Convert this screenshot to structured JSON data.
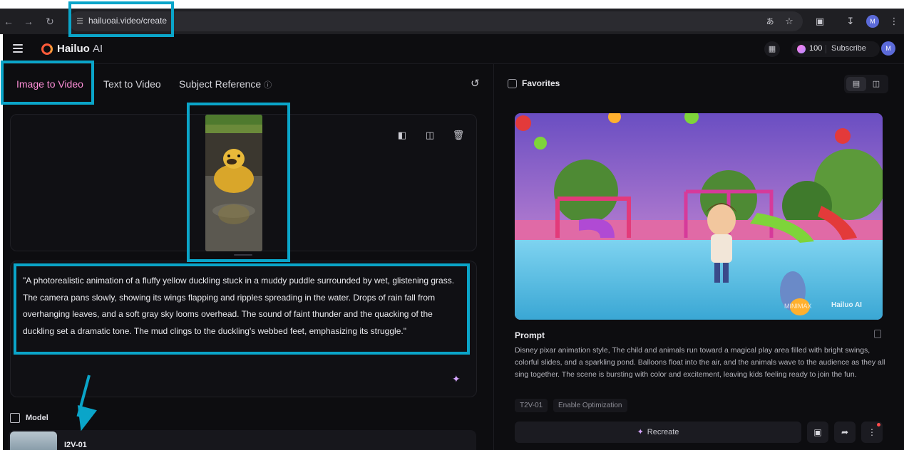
{
  "browser": {
    "url": "hailuoai.video/create",
    "profile_initial": "M"
  },
  "header": {
    "brand_name": "Hailuo",
    "brand_suffix": "AI",
    "credits": "100",
    "subscribe_label": "Subscribe",
    "avatar_initial": "M"
  },
  "tabs": [
    {
      "label": "Image to Video",
      "active": true
    },
    {
      "label": "Text to Video",
      "active": false
    },
    {
      "label": "Subject Reference",
      "active": false
    }
  ],
  "subject_reference_info_glyph": "ⓘ",
  "prompt": {
    "text": "\"A photorealistic animation of a fluffy yellow duckling stuck in a muddy puddle surrounded by wet, glistening grass. The camera pans slowly, showing its wings flapping and ripples spreading in the water. Drops of rain fall from overhanging leaves, and a soft gray sky looms overhead. The sound of faint thunder and the quacking of the duckling set a dramatic tone. The mud clings to the duckling's webbed feet, emphasizing its struggle.\""
  },
  "model": {
    "section_label": "Model",
    "name": "I2V-01"
  },
  "favorites": {
    "label": "Favorites"
  },
  "preview": {
    "watermark_left": "MINIMAX",
    "watermark_right": "Hailuo AI",
    "prompt_title": "Prompt",
    "prompt_text": "Disney pixar animation style, The child and animals run toward a magical play area filled with bright swings, colorful slides, and a sparkling pond. Balloons float into the air, and the animals wave to the audience as they all sing together. The scene is bursting with color and excitement, leaving kids feeling ready to join the fun.",
    "tags": [
      "T2V-01",
      "Enable Optimization"
    ],
    "recreate_label": "Recreate"
  },
  "icons": {
    "back": "arrow-left-icon",
    "forward": "arrow-right-icon",
    "reload": "reload-icon",
    "site_settings": "site-settings-icon",
    "translate": "translate-icon",
    "star": "star-icon",
    "extensions": "puzzle-icon",
    "download": "download-icon",
    "kebab": "kebab-icon"
  },
  "colors": {
    "accent_pink": "#ff8fd8",
    "annotation_cyan": "#0aa5c9",
    "app_bg": "#0d0d10"
  }
}
